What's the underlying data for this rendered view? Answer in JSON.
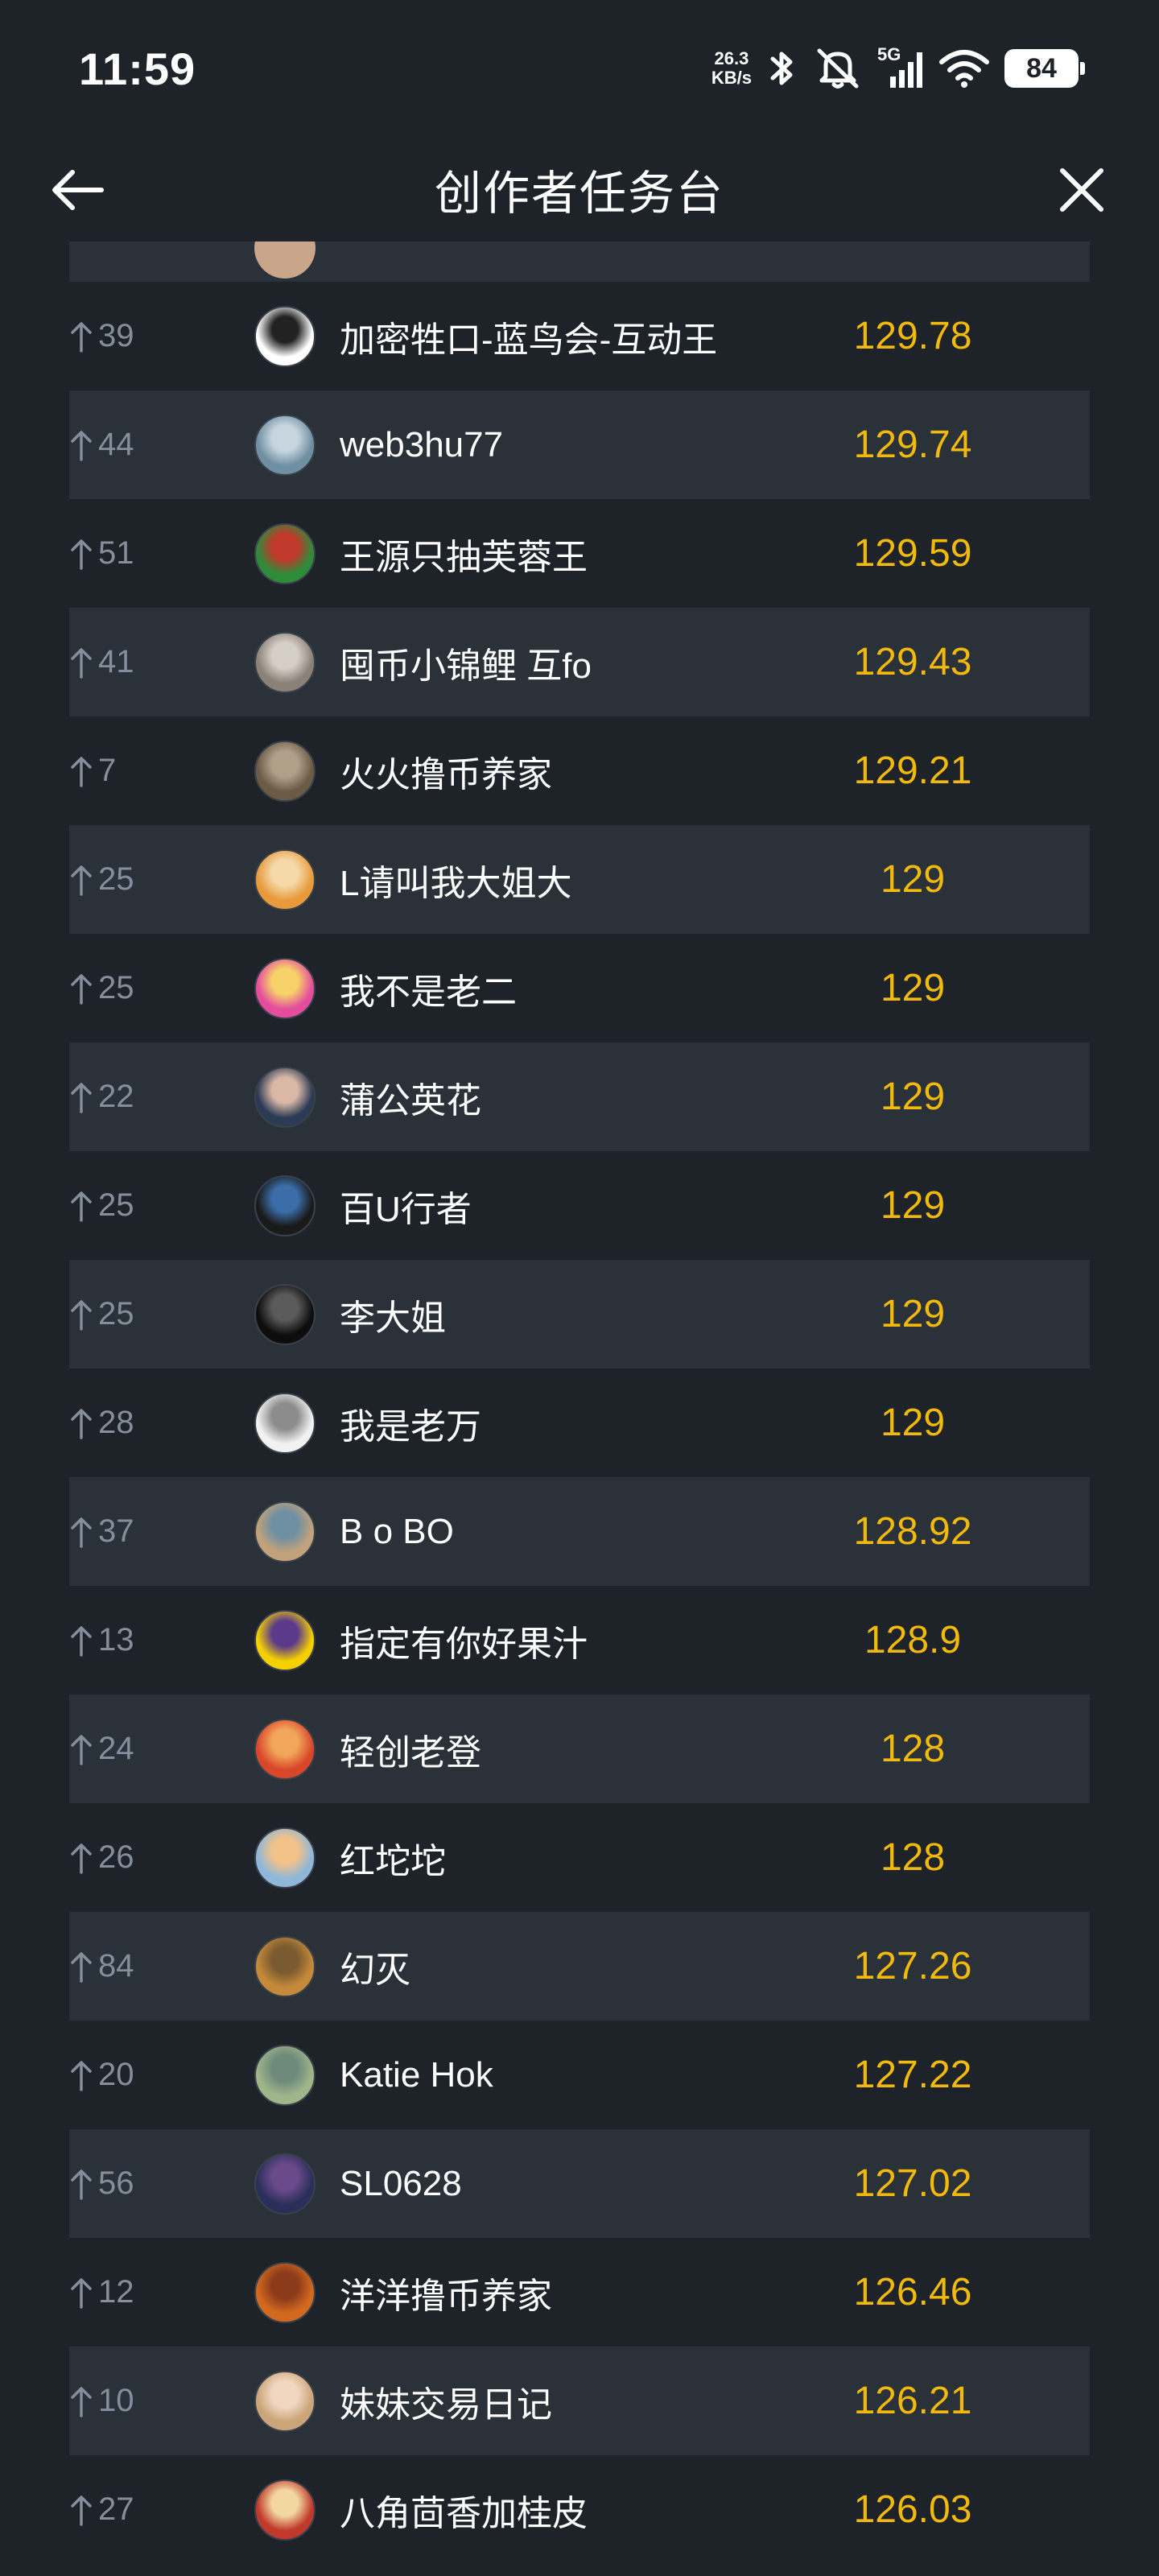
{
  "status_bar": {
    "time": "11:59",
    "net_speed_value": "26.3",
    "net_speed_unit": "KB/s",
    "network_label": "5G",
    "battery": "84",
    "icons": [
      "bluetooth-icon",
      "mute-icon",
      "signal-icon",
      "wifi-icon",
      "battery-icon"
    ]
  },
  "header": {
    "title": "创作者任务台",
    "back_icon": "back-arrow-icon",
    "close_icon": "close-icon"
  },
  "colors": {
    "background": "#1e2329",
    "row_alt": "#2b3139",
    "score": "#f0b90b",
    "rank_change": "#848e9c",
    "text": "#ffffff"
  },
  "rows": [
    {
      "change": "39",
      "name": "加密牲口-蓝鸟会-互动王",
      "score": "129.78",
      "avatar": "panda-avatar",
      "colors": [
        "#ffffff",
        "#222222"
      ]
    },
    {
      "change": "44",
      "name": "web3hu77",
      "score": "129.74",
      "avatar": "landscape-avatar",
      "colors": [
        "#6f8fa3",
        "#c7d6de"
      ]
    },
    {
      "change": "51",
      "name": "王源只抽芙蓉王",
      "score": "129.59",
      "avatar": "zoro-avatar",
      "colors": [
        "#2e8b3a",
        "#c0392b"
      ]
    },
    {
      "change": "41",
      "name": "囤币小锦鲤 互fo",
      "score": "129.43",
      "avatar": "cat-avatar",
      "colors": [
        "#8a8178",
        "#d6cfc7"
      ]
    },
    {
      "change": "7",
      "name": "火火撸币养家",
      "score": "129.21",
      "avatar": "room-avatar",
      "colors": [
        "#6b5a45",
        "#b0a08a"
      ]
    },
    {
      "change": "25",
      "name": "L请叫我大姐大",
      "score": "129",
      "avatar": "food-avatar",
      "colors": [
        "#e89a3c",
        "#f5d9a8"
      ]
    },
    {
      "change": "25",
      "name": "我不是老二",
      "score": "129",
      "avatar": "woman-rainbow-avatar",
      "colors": [
        "#e44d9c",
        "#f7d26a"
      ]
    },
    {
      "change": "22",
      "name": "蒲公英花",
      "score": "129",
      "avatar": "woman-portrait-avatar",
      "colors": [
        "#2b3a55",
        "#d9b8a5"
      ]
    },
    {
      "change": "25",
      "name": "百U行者",
      "score": "129",
      "avatar": "man-dark-avatar",
      "colors": [
        "#1a1a1a",
        "#3b6ea8"
      ]
    },
    {
      "change": "25",
      "name": "李大姐",
      "score": "129",
      "avatar": "silhouette-avatar",
      "colors": [
        "#0d0d0d",
        "#5a5a5a"
      ]
    },
    {
      "change": "28",
      "name": "我是老万",
      "score": "129",
      "avatar": "sketch-avatar",
      "colors": [
        "#f2f2f2",
        "#8c8c8c"
      ]
    },
    {
      "change": "37",
      "name": "B o BO",
      "score": "128.92",
      "avatar": "kitten-avatar",
      "colors": [
        "#c2a27a",
        "#6f8fa3"
      ]
    },
    {
      "change": "13",
      "name": "指定有你好果汁",
      "score": "128.9",
      "avatar": "smiley-avatar",
      "colors": [
        "#f5d000",
        "#5b3a8c"
      ]
    },
    {
      "change": "24",
      "name": "轻创老登",
      "score": "128",
      "avatar": "crayfish-avatar",
      "colors": [
        "#d9472b",
        "#f2a65a"
      ]
    },
    {
      "change": "26",
      "name": "红坨坨",
      "score": "128",
      "avatar": "sunset-avatar",
      "colors": [
        "#8fb7d9",
        "#f2c28a"
      ]
    },
    {
      "change": "84",
      "name": "幻灭",
      "score": "127.26",
      "avatar": "bread-avatar",
      "colors": [
        "#c48a3a",
        "#7a5a30"
      ]
    },
    {
      "change": "20",
      "name": "Katie Hok",
      "score": "127.22",
      "avatar": "frog-avatar",
      "colors": [
        "#9fb58a",
        "#6e8a7a"
      ]
    },
    {
      "change": "56",
      "name": "SL0628",
      "score": "127.02",
      "avatar": "galaxy-avatar",
      "colors": [
        "#2a2f5a",
        "#6a4a8a"
      ]
    },
    {
      "change": "12",
      "name": "洋洋撸币养家",
      "score": "126.46",
      "avatar": "autumn-avatar",
      "colors": [
        "#d2691e",
        "#8b3a1a"
      ]
    },
    {
      "change": "10",
      "name": "妹妹交易日记",
      "score": "126.21",
      "avatar": "girl-avatar",
      "colors": [
        "#caa57a",
        "#f2d7c0"
      ]
    },
    {
      "change": "27",
      "name": "八角茴香加桂皮",
      "score": "126.03",
      "avatar": "rooster-avatar",
      "colors": [
        "#c0392b",
        "#f2d7a0"
      ]
    }
  ]
}
